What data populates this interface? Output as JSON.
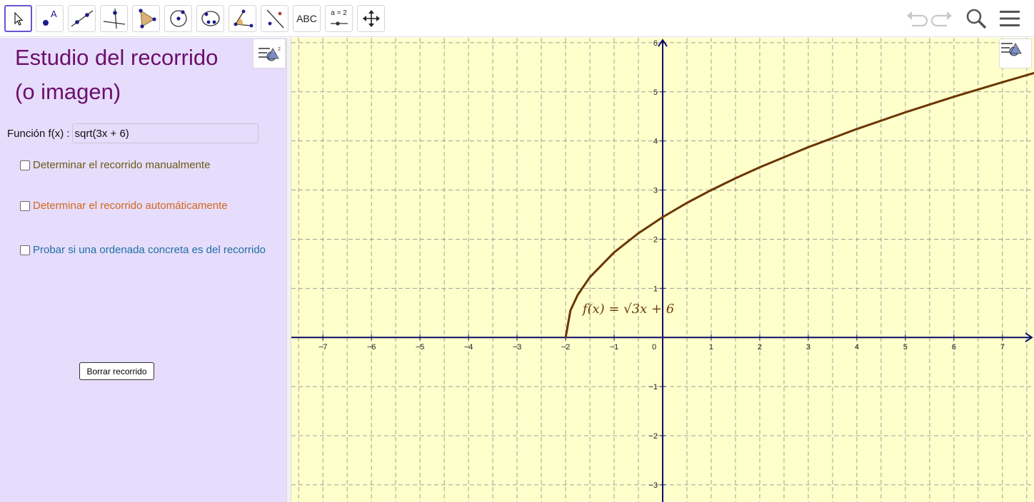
{
  "toolbar": {
    "tools": [
      {
        "name": "move-tool",
        "icon": "arrow-pointer-icon",
        "active": true
      },
      {
        "name": "point-tool",
        "icon": "point-icon"
      },
      {
        "name": "line-tool",
        "icon": "line-through-points-icon"
      },
      {
        "name": "perpendicular-tool",
        "icon": "perpendicular-line-icon"
      },
      {
        "name": "polygon-tool",
        "icon": "polygon-icon"
      },
      {
        "name": "circle-tool",
        "icon": "circle-center-point-icon"
      },
      {
        "name": "conic-tool",
        "icon": "ellipse-icon"
      },
      {
        "name": "angle-tool",
        "icon": "angle-icon"
      },
      {
        "name": "reflect-tool",
        "icon": "reflect-line-icon"
      },
      {
        "name": "text-tool",
        "label": "ABC"
      },
      {
        "name": "slider-tool",
        "label": "a = 2"
      },
      {
        "name": "move-view-tool",
        "icon": "move-graphics-view-icon"
      }
    ],
    "right": [
      "undo-icon",
      "redo-icon",
      "search-icon",
      "menu-icon"
    ]
  },
  "panel": {
    "title_line1": "Estudio del recorrido",
    "title_line2": "(o imagen)",
    "function_label": "Función f(x) :",
    "function_value": "sqrt(3x + 6)",
    "checkboxes": [
      {
        "label": "Determinar el recorrido manualmente",
        "color": "#6b5a17",
        "checked": false
      },
      {
        "label": "Determinar el recorrido automáticamente",
        "color": "#d2691e",
        "checked": false
      },
      {
        "label": "Probar si una ordenada concreta es del recorrido",
        "color": "#1f6fa3",
        "checked": false
      }
    ],
    "button_label": "Borrar recorrido"
  },
  "graph": {
    "x_ticks": [
      "−7",
      "−6",
      "−5",
      "−4",
      "−3",
      "−2",
      "−1",
      "0",
      "1",
      "2",
      "3",
      "4",
      "5",
      "6",
      "7"
    ],
    "y_ticks": [
      "−3",
      "−2",
      "−1",
      "1",
      "2",
      "3",
      "4",
      "5",
      "6"
    ],
    "function_label": "f(x) = √3x + 6",
    "curve_color": "#6a3500",
    "axis_color": "#0b0b6b",
    "background": "#ffffcc"
  },
  "chart_data": {
    "type": "line",
    "series": [
      {
        "name": "f(x)",
        "x": [
          -2,
          -1.9,
          -1.75,
          -1.5,
          -1,
          -0.5,
          0,
          0.5,
          1,
          1.5,
          2,
          3,
          4,
          5,
          6,
          7,
          7.65
        ],
        "y": [
          0,
          0.548,
          0.866,
          1.225,
          1.732,
          2.121,
          2.449,
          2.739,
          3,
          3.24,
          3.464,
          3.873,
          4.243,
          4.583,
          4.899,
          5.196,
          5.381
        ]
      }
    ],
    "xlim": [
      -7.65,
      7.65
    ],
    "ylim": [
      -3.35,
      6.1
    ],
    "grid": true
  }
}
